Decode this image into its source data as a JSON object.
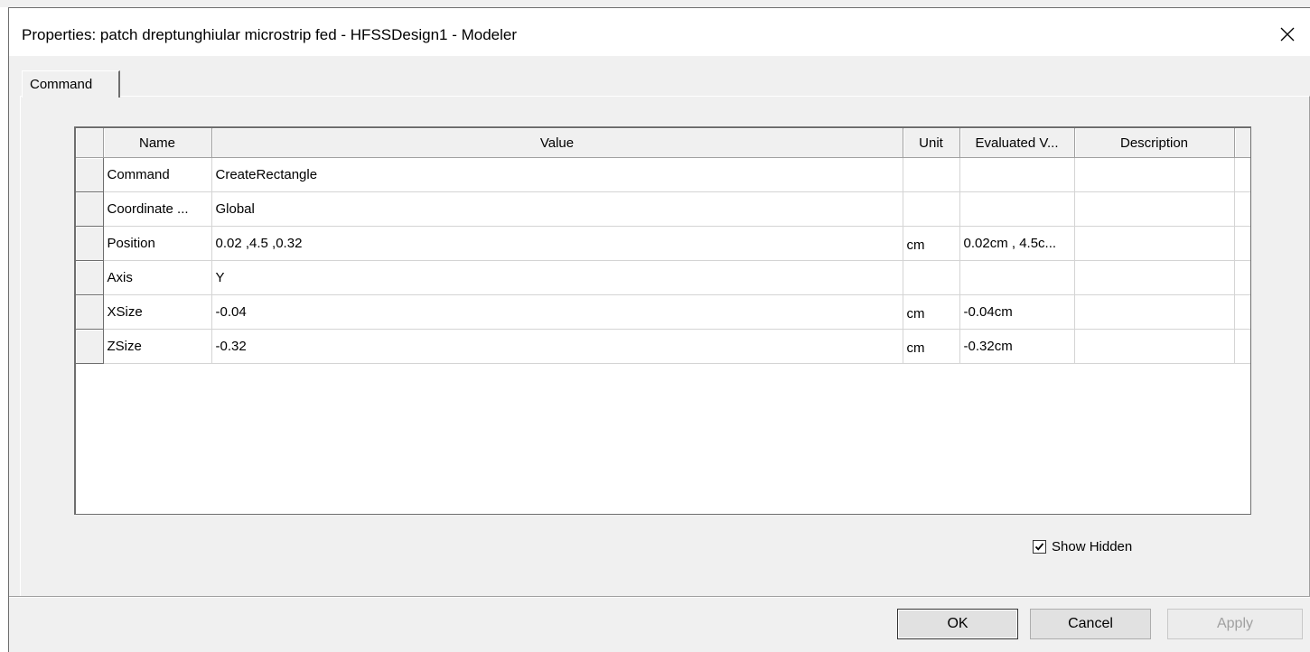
{
  "window": {
    "title": "Properties: patch dreptunghiular microstrip fed - HFSSDesign1 - Modeler",
    "close_glyph": "✕"
  },
  "tabs": [
    {
      "label": "Command",
      "selected": true
    }
  ],
  "grid": {
    "columns": [
      "Name",
      "Value",
      "Unit",
      "Evaluated V...",
      "Description"
    ],
    "rows": [
      {
        "name": "Command",
        "value": "CreateRectangle",
        "unit": "",
        "evaluated": "",
        "description": ""
      },
      {
        "name": "Coordinate ...",
        "value": "Global",
        "unit": "",
        "evaluated": "",
        "description": ""
      },
      {
        "name": "Position",
        "value": "0.02 ,4.5 ,0.32",
        "unit": "cm",
        "evaluated": "0.02cm , 4.5c...",
        "description": ""
      },
      {
        "name": "Axis",
        "value": "Y",
        "unit": "",
        "evaluated": "",
        "description": ""
      },
      {
        "name": "XSize",
        "value": "-0.04",
        "unit": "cm",
        "evaluated": "-0.04cm",
        "description": ""
      },
      {
        "name": "ZSize",
        "value": "-0.32",
        "unit": "cm",
        "evaluated": "-0.32cm",
        "description": ""
      }
    ]
  },
  "show_hidden": {
    "label": "Show Hidden",
    "checked": true
  },
  "buttons": {
    "ok": "OK",
    "cancel": "Cancel",
    "apply": "Apply",
    "apply_enabled": false
  },
  "icons": {
    "close": "close-icon",
    "check": "checkmark-icon"
  }
}
